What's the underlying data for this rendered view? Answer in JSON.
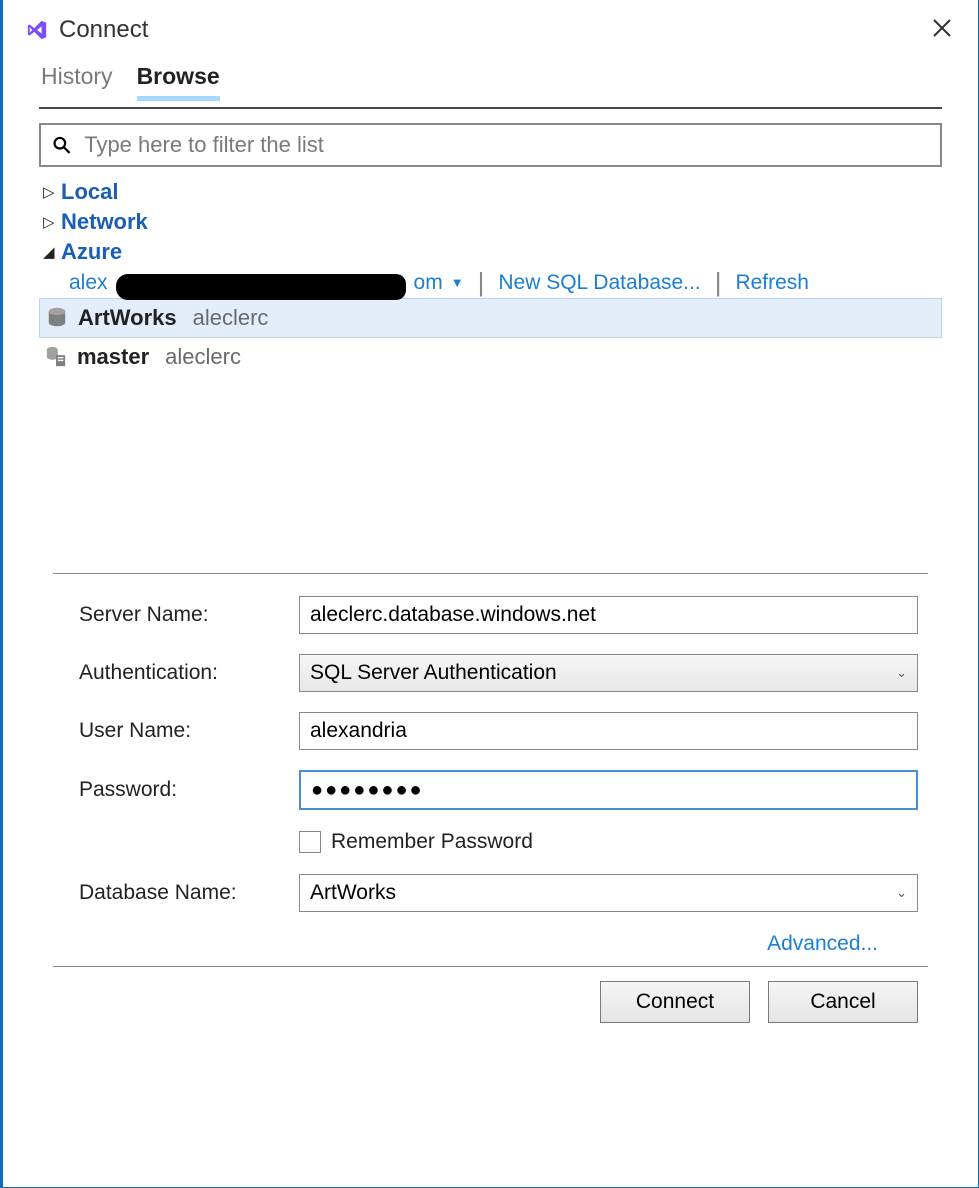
{
  "header": {
    "title": "Connect"
  },
  "tabs": {
    "history": "History",
    "browse": "Browse"
  },
  "filter": {
    "placeholder": "Type here to filter the list"
  },
  "tree": {
    "local": "Local",
    "network": "Network",
    "azure": "Azure",
    "account_prefix": "alex",
    "account_suffix": "om",
    "new_db": "New SQL Database...",
    "refresh": "Refresh",
    "databases": [
      {
        "name": "ArtWorks",
        "server": "aleclerc",
        "selected": true
      },
      {
        "name": "master",
        "server": "aleclerc",
        "selected": false
      }
    ]
  },
  "form": {
    "server_label": "Server Name:",
    "server_value": "aleclerc.database.windows.net",
    "auth_label": "Authentication:",
    "auth_value": "SQL Server Authentication",
    "user_label": "User Name:",
    "user_value": "alexandria",
    "password_label": "Password:",
    "password_value": "●●●●●●●●",
    "remember_label": "Remember Password",
    "dbname_label": "Database Name:",
    "dbname_value": "ArtWorks",
    "advanced": "Advanced..."
  },
  "buttons": {
    "connect": "Connect",
    "cancel": "Cancel"
  }
}
